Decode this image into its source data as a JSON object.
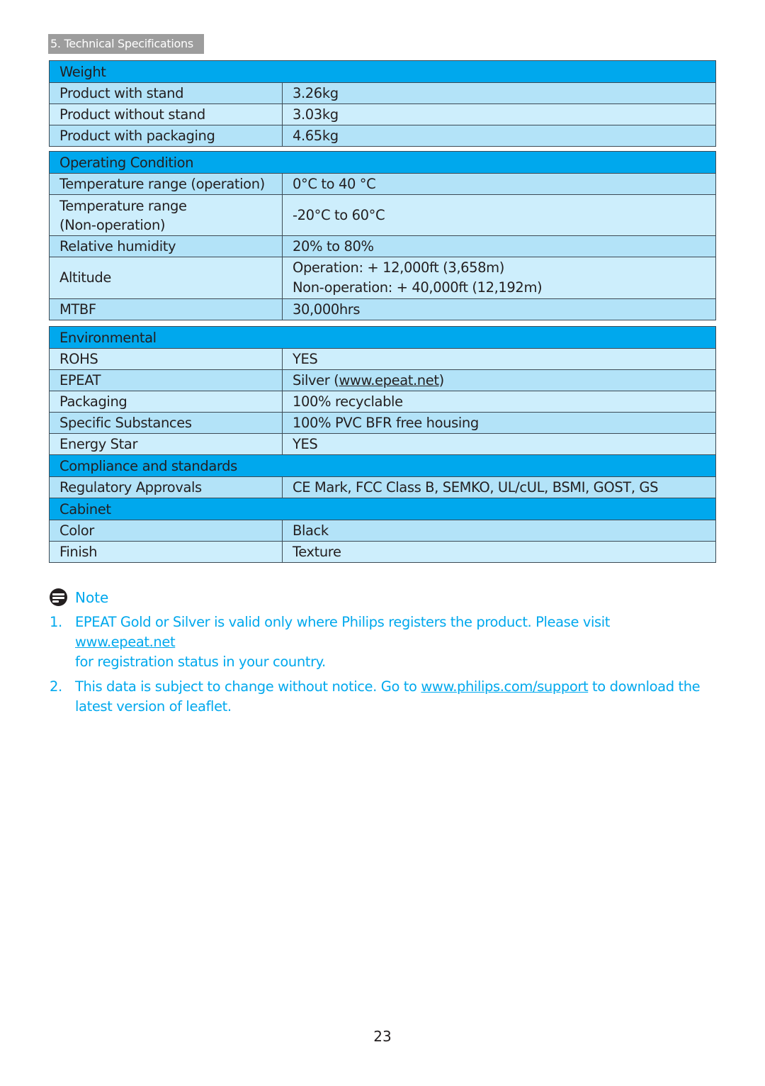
{
  "section_tag": "5. Technical Specifications",
  "colors": {
    "header_blue": "#00a8ed",
    "row_dark": "#b3e3f8",
    "row_light": "#cdeefc",
    "note_text": "#00a8ed",
    "section_tag_bg": "#9d9d9d"
  },
  "tables": [
    {
      "title": "Weight",
      "rows": [
        {
          "label": "Product with stand",
          "value": "3.26kg"
        },
        {
          "label": "Product without stand",
          "value": "3.03kg"
        },
        {
          "label": "Product with packaging",
          "value": "4.65kg"
        }
      ]
    },
    {
      "title": "Operating Condition",
      "rows": [
        {
          "label": "Temperature range (operation)",
          "value": "0°C to 40 °C"
        },
        {
          "label_lines": [
            "Temperature range",
            "(Non-operation)"
          ],
          "value": "-20°C to 60°C"
        },
        {
          "label": "Relative humidity",
          "value": "20% to 80%"
        },
        {
          "label": "Altitude",
          "value_lines": [
            "Operation: + 12,000ft (3,658m)",
            "Non-operation: + 40,000ft (12,192m)"
          ]
        },
        {
          "label": "MTBF",
          "value": "30,000hrs"
        }
      ]
    },
    {
      "title": "Environmental",
      "rows": [
        {
          "label": "ROHS",
          "value": "YES"
        },
        {
          "label": "EPEAT",
          "value_prefix": "Silver (",
          "value_link": "www.epeat.net",
          "value_suffix": ")"
        },
        {
          "label": "Packaging",
          "value": "100% recyclable"
        },
        {
          "label": "Specific Substances",
          "value": "100% PVC BFR free housing"
        },
        {
          "label": "Energy Star",
          "value": "YES"
        }
      ]
    },
    {
      "title": "Compliance and standards",
      "rows": [
        {
          "label": "Regulatory Approvals",
          "value": "CE Mark, FCC Class B, SEMKO, UL/cUL,  BSMI, GOST, GS"
        }
      ]
    },
    {
      "title": "Cabinet",
      "rows": [
        {
          "label": "Color",
          "value": "Black"
        },
        {
          "label": "Finish",
          "value": "Texture"
        }
      ]
    }
  ],
  "note": {
    "icon": "note-icon",
    "label": "Note",
    "items": [
      {
        "num": "1.",
        "line1_text": "EPEAT Gold or Silver is valid only where Philips registers the product. Please visit ",
        "line1_link": "www.epeat.net",
        "line2_text": "for registration status in your country."
      },
      {
        "num": "2.",
        "line1_text": "This data is subject to change without notice. Go to ",
        "line1_link": "www.philips.com/support",
        "line1_after": " to download the",
        "line2_text": "latest version of leaflet."
      }
    ]
  },
  "page_number": "23"
}
